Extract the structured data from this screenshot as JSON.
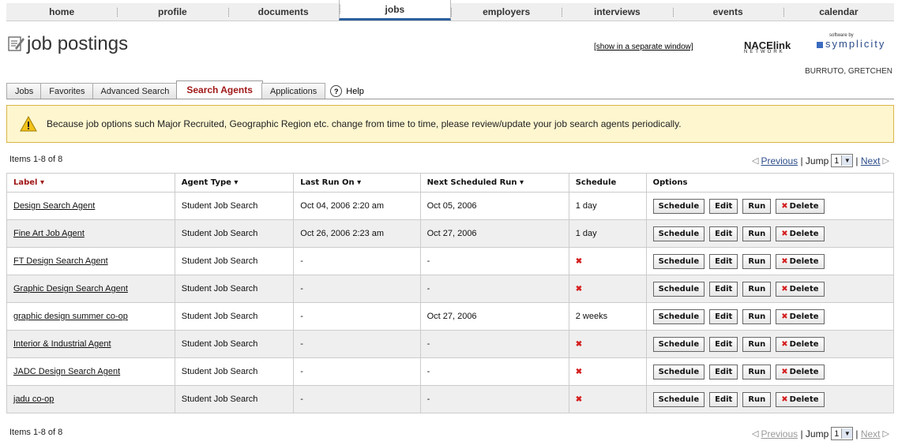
{
  "nav": [
    "home",
    "profile",
    "documents",
    "jobs",
    "employers",
    "interviews",
    "events",
    "calendar"
  ],
  "nav_active": "jobs",
  "header": {
    "title": "job postings",
    "separate_window": "[show in a separate window]",
    "nace_logo": "NACElink",
    "nace_network": "NETWORK",
    "software_by": "software by",
    "symplicity": "symplicity"
  },
  "user": "BURRUTO, GRETCHEN",
  "tabs": [
    "Jobs",
    "Favorites",
    "Advanced Search",
    "Search Agents",
    "Applications"
  ],
  "tab_active": "Search Agents",
  "help": "Help",
  "alert": "Because job options such Major Recruited, Geographic Region etc. change from time to time, please review/update your job search agents periodically.",
  "items_text": "Items 1-8 of 8",
  "pager": {
    "previous": "Previous",
    "jump": "Jump",
    "page": "1",
    "next": "Next"
  },
  "columns": [
    "Label ▾",
    "Agent Type ▾",
    "Last Run On ▾",
    "Next Scheduled Run ▾",
    "Schedule",
    "Options"
  ],
  "rows": [
    {
      "label": "Design Search Agent",
      "type": "Student Job Search",
      "last": "Oct 04, 2006 2:20 am",
      "next": "Oct 05, 2006",
      "schedule": "1 day"
    },
    {
      "label": "Fine Art Job Agent",
      "type": "Student Job Search",
      "last": "Oct 26, 2006 2:23 am",
      "next": "Oct 27, 2006",
      "schedule": "1 day"
    },
    {
      "label": "FT Design Search Agent",
      "type": "Student Job Search",
      "last": "-",
      "next": "-",
      "schedule": "✖"
    },
    {
      "label": "Graphic Design Search Agent",
      "type": "Student Job Search",
      "last": "-",
      "next": "-",
      "schedule": "✖"
    },
    {
      "label": "graphic design summer co-op",
      "type": "Student Job Search",
      "last": "-",
      "next": "Oct 27, 2006",
      "schedule": "2 weeks"
    },
    {
      "label": "Interior & Industrial Agent",
      "type": "Student Job Search",
      "last": "-",
      "next": "-",
      "schedule": "✖"
    },
    {
      "label": "JADC Design Search Agent",
      "type": "Student Job Search",
      "last": "-",
      "next": "-",
      "schedule": "✖"
    },
    {
      "label": "jadu co-op",
      "type": "Student Job Search",
      "last": "-",
      "next": "-",
      "schedule": "✖"
    }
  ],
  "buttons": {
    "schedule": "Schedule",
    "edit": "Edit",
    "run": "Run",
    "delete": "Delete"
  },
  "colors": {
    "accent": "#a01818",
    "nav_active": "#2c5f9e",
    "alert_bg": "#fdf6cf",
    "alt_row": "#efefef"
  }
}
